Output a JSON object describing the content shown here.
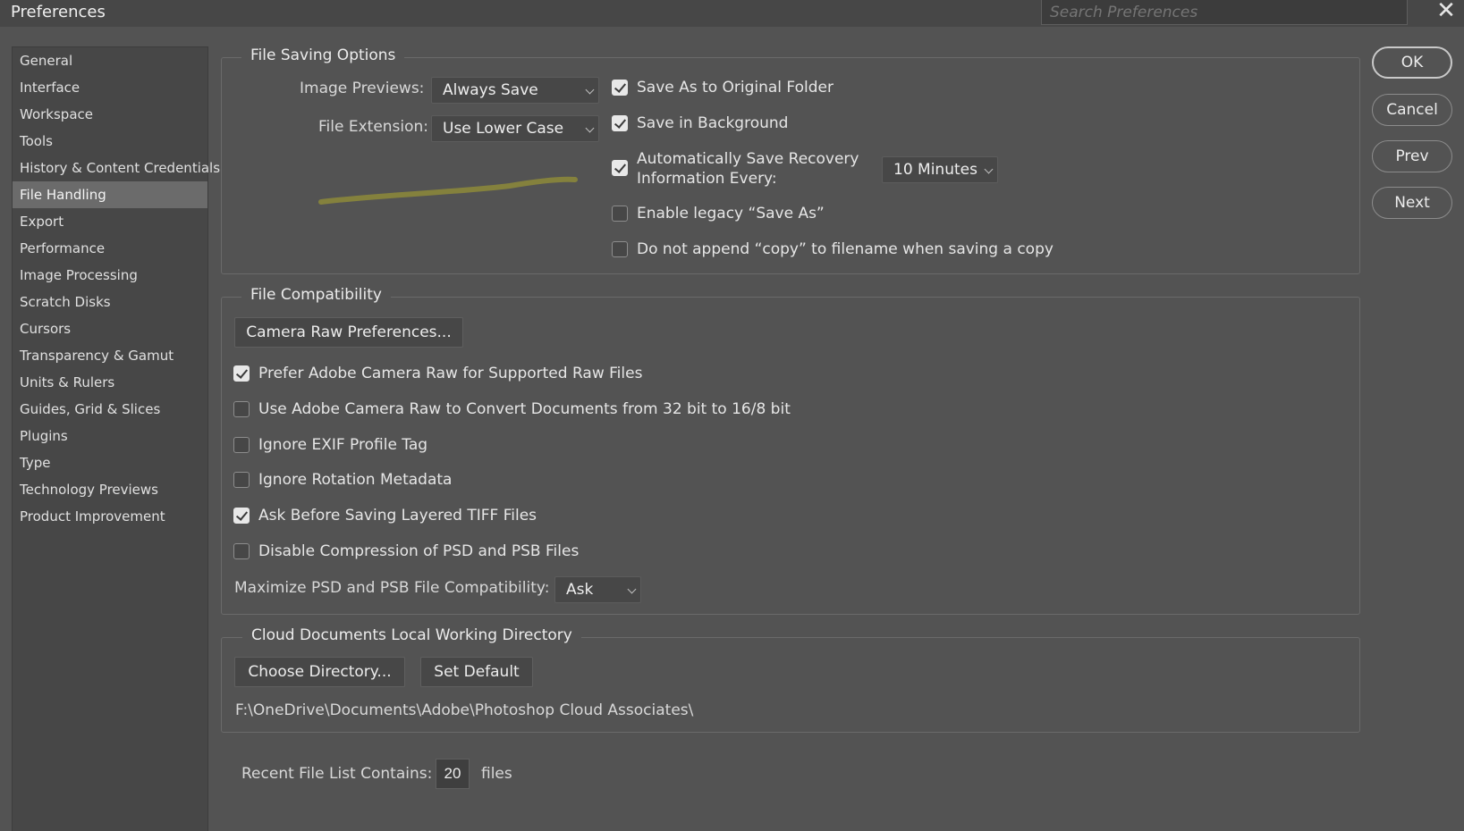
{
  "window": {
    "title": "Preferences",
    "close_icon": "close-icon"
  },
  "search": {
    "placeholder": "Search Preferences"
  },
  "sidebar": {
    "active": "File Handling",
    "items": [
      {
        "label": "General"
      },
      {
        "label": "Interface"
      },
      {
        "label": "Workspace"
      },
      {
        "label": "Tools"
      },
      {
        "label": "History & Content Credentials"
      },
      {
        "label": "File Handling"
      },
      {
        "label": "Export"
      },
      {
        "label": "Performance"
      },
      {
        "label": "Image Processing"
      },
      {
        "label": "Scratch Disks"
      },
      {
        "label": "Cursors"
      },
      {
        "label": "Transparency & Gamut"
      },
      {
        "label": "Units & Rulers"
      },
      {
        "label": "Guides, Grid & Slices"
      },
      {
        "label": "Plugins"
      },
      {
        "label": "Type"
      },
      {
        "label": "Technology Previews"
      },
      {
        "label": "Product Improvement"
      }
    ]
  },
  "buttons": {
    "ok": "OK",
    "cancel": "Cancel",
    "prev": "Prev",
    "next": "Next"
  },
  "file_saving": {
    "title": "File Saving Options",
    "image_previews_label": "Image Previews:",
    "image_previews_value": "Always Save",
    "file_extension_label": "File Extension:",
    "file_extension_value": "Use Lower Case",
    "save_as_original": {
      "label": "Save As to Original Folder",
      "checked": true
    },
    "save_in_background": {
      "label": "Save in Background",
      "checked": true
    },
    "auto_save": {
      "label_line1": "Automatically Save Recovery",
      "label_line2": "Information Every:",
      "checked": true
    },
    "auto_save_interval": "10 Minutes",
    "legacy_save_as": {
      "label": "Enable legacy “Save As”",
      "checked": false
    },
    "no_copy_append": {
      "label": "Do not append “copy” to filename when saving a copy",
      "checked": false
    }
  },
  "file_compat": {
    "title": "File Compatibility",
    "camera_raw_button": "Camera Raw Preferences...",
    "options": [
      {
        "label": "Prefer Adobe Camera Raw for Supported Raw Files",
        "checked": true
      },
      {
        "label": "Use Adobe Camera Raw to Convert Documents from 32 bit to 16/8 bit",
        "checked": false
      },
      {
        "label": "Ignore EXIF Profile Tag",
        "checked": false
      },
      {
        "label": "Ignore Rotation Metadata",
        "checked": false
      },
      {
        "label": "Ask Before Saving Layered TIFF Files",
        "checked": true
      },
      {
        "label": "Disable Compression of PSD and PSB Files",
        "checked": false
      }
    ],
    "maximize_label": "Maximize PSD and PSB File Compatibility:",
    "maximize_value": "Ask"
  },
  "cloud_docs": {
    "title": "Cloud Documents Local Working Directory",
    "choose_button": "Choose Directory...",
    "default_button": "Set Default",
    "path": "F:\\OneDrive\\Documents\\Adobe\\Photoshop Cloud Associates\\"
  },
  "recent_files": {
    "label": "Recent File List Contains:",
    "value": "20",
    "suffix": "files"
  },
  "colors": {
    "background": "#535353",
    "panel": "#474747",
    "selected": "#6b6b6b",
    "stroke": "#8d8a3a"
  }
}
